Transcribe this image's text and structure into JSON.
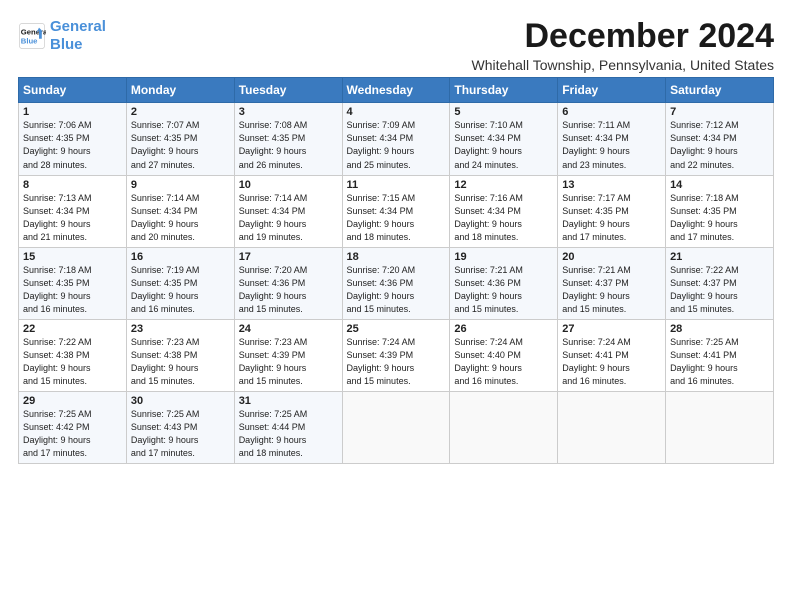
{
  "header": {
    "logo_line1": "General",
    "logo_line2": "Blue",
    "month": "December 2024",
    "location": "Whitehall Township, Pennsylvania, United States"
  },
  "days_of_week": [
    "Sunday",
    "Monday",
    "Tuesday",
    "Wednesday",
    "Thursday",
    "Friday",
    "Saturday"
  ],
  "weeks": [
    [
      {
        "day": "1",
        "info": "Sunrise: 7:06 AM\nSunset: 4:35 PM\nDaylight: 9 hours\nand 28 minutes."
      },
      {
        "day": "2",
        "info": "Sunrise: 7:07 AM\nSunset: 4:35 PM\nDaylight: 9 hours\nand 27 minutes."
      },
      {
        "day": "3",
        "info": "Sunrise: 7:08 AM\nSunset: 4:35 PM\nDaylight: 9 hours\nand 26 minutes."
      },
      {
        "day": "4",
        "info": "Sunrise: 7:09 AM\nSunset: 4:34 PM\nDaylight: 9 hours\nand 25 minutes."
      },
      {
        "day": "5",
        "info": "Sunrise: 7:10 AM\nSunset: 4:34 PM\nDaylight: 9 hours\nand 24 minutes."
      },
      {
        "day": "6",
        "info": "Sunrise: 7:11 AM\nSunset: 4:34 PM\nDaylight: 9 hours\nand 23 minutes."
      },
      {
        "day": "7",
        "info": "Sunrise: 7:12 AM\nSunset: 4:34 PM\nDaylight: 9 hours\nand 22 minutes."
      }
    ],
    [
      {
        "day": "8",
        "info": "Sunrise: 7:13 AM\nSunset: 4:34 PM\nDaylight: 9 hours\nand 21 minutes."
      },
      {
        "day": "9",
        "info": "Sunrise: 7:14 AM\nSunset: 4:34 PM\nDaylight: 9 hours\nand 20 minutes."
      },
      {
        "day": "10",
        "info": "Sunrise: 7:14 AM\nSunset: 4:34 PM\nDaylight: 9 hours\nand 19 minutes."
      },
      {
        "day": "11",
        "info": "Sunrise: 7:15 AM\nSunset: 4:34 PM\nDaylight: 9 hours\nand 18 minutes."
      },
      {
        "day": "12",
        "info": "Sunrise: 7:16 AM\nSunset: 4:34 PM\nDaylight: 9 hours\nand 18 minutes."
      },
      {
        "day": "13",
        "info": "Sunrise: 7:17 AM\nSunset: 4:35 PM\nDaylight: 9 hours\nand 17 minutes."
      },
      {
        "day": "14",
        "info": "Sunrise: 7:18 AM\nSunset: 4:35 PM\nDaylight: 9 hours\nand 17 minutes."
      }
    ],
    [
      {
        "day": "15",
        "info": "Sunrise: 7:18 AM\nSunset: 4:35 PM\nDaylight: 9 hours\nand 16 minutes."
      },
      {
        "day": "16",
        "info": "Sunrise: 7:19 AM\nSunset: 4:35 PM\nDaylight: 9 hours\nand 16 minutes."
      },
      {
        "day": "17",
        "info": "Sunrise: 7:20 AM\nSunset: 4:36 PM\nDaylight: 9 hours\nand 15 minutes."
      },
      {
        "day": "18",
        "info": "Sunrise: 7:20 AM\nSunset: 4:36 PM\nDaylight: 9 hours\nand 15 minutes."
      },
      {
        "day": "19",
        "info": "Sunrise: 7:21 AM\nSunset: 4:36 PM\nDaylight: 9 hours\nand 15 minutes."
      },
      {
        "day": "20",
        "info": "Sunrise: 7:21 AM\nSunset: 4:37 PM\nDaylight: 9 hours\nand 15 minutes."
      },
      {
        "day": "21",
        "info": "Sunrise: 7:22 AM\nSunset: 4:37 PM\nDaylight: 9 hours\nand 15 minutes."
      }
    ],
    [
      {
        "day": "22",
        "info": "Sunrise: 7:22 AM\nSunset: 4:38 PM\nDaylight: 9 hours\nand 15 minutes."
      },
      {
        "day": "23",
        "info": "Sunrise: 7:23 AM\nSunset: 4:38 PM\nDaylight: 9 hours\nand 15 minutes."
      },
      {
        "day": "24",
        "info": "Sunrise: 7:23 AM\nSunset: 4:39 PM\nDaylight: 9 hours\nand 15 minutes."
      },
      {
        "day": "25",
        "info": "Sunrise: 7:24 AM\nSunset: 4:39 PM\nDaylight: 9 hours\nand 15 minutes."
      },
      {
        "day": "26",
        "info": "Sunrise: 7:24 AM\nSunset: 4:40 PM\nDaylight: 9 hours\nand 16 minutes."
      },
      {
        "day": "27",
        "info": "Sunrise: 7:24 AM\nSunset: 4:41 PM\nDaylight: 9 hours\nand 16 minutes."
      },
      {
        "day": "28",
        "info": "Sunrise: 7:25 AM\nSunset: 4:41 PM\nDaylight: 9 hours\nand 16 minutes."
      }
    ],
    [
      {
        "day": "29",
        "info": "Sunrise: 7:25 AM\nSunset: 4:42 PM\nDaylight: 9 hours\nand 17 minutes."
      },
      {
        "day": "30",
        "info": "Sunrise: 7:25 AM\nSunset: 4:43 PM\nDaylight: 9 hours\nand 17 minutes."
      },
      {
        "day": "31",
        "info": "Sunrise: 7:25 AM\nSunset: 4:44 PM\nDaylight: 9 hours\nand 18 minutes."
      },
      {
        "day": "",
        "info": ""
      },
      {
        "day": "",
        "info": ""
      },
      {
        "day": "",
        "info": ""
      },
      {
        "day": "",
        "info": ""
      }
    ]
  ]
}
